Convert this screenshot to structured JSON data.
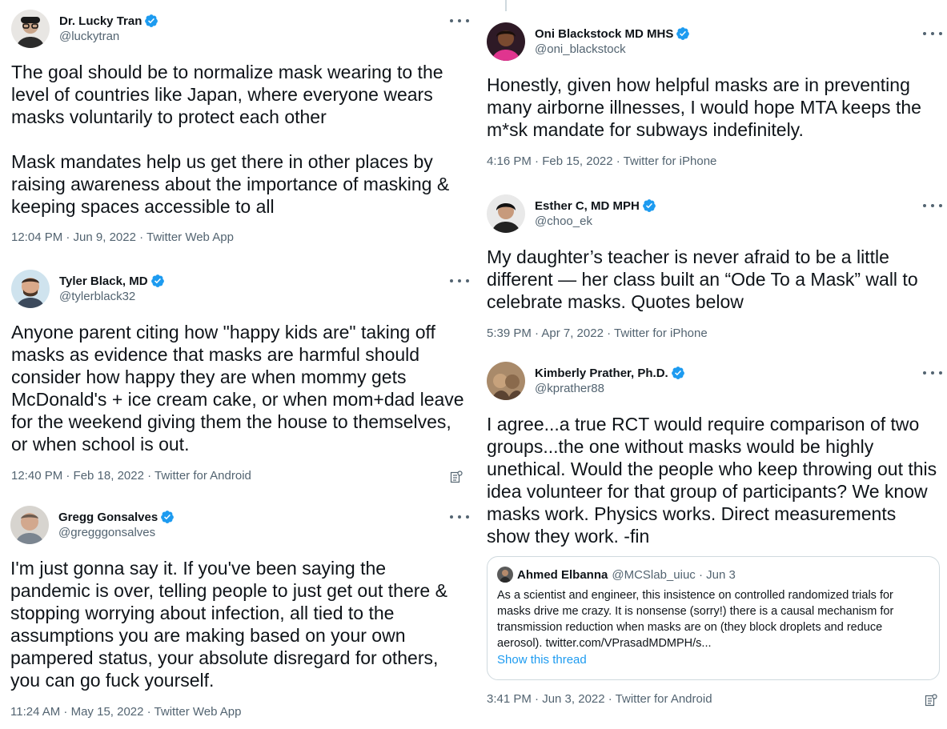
{
  "colors": {
    "verified": "#1d9bf0",
    "secondary_text": "#536471",
    "link": "#1d9bf0",
    "border": "#cfd9de"
  },
  "tweets": [
    {
      "name": "Dr. Lucky Tran",
      "handle": "@luckytran",
      "paragraphs": [
        "The goal should be to normalize mask wearing to the level of countries like Japan, where everyone wears masks voluntarily to protect each other",
        "Mask mandates help us get there in other places by raising awareness about the importance of masking & keeping spaces accessible to all"
      ],
      "meta": "12:04 PM · Jun 9, 2022 · Twitter Web App"
    },
    {
      "name": "Tyler Black, MD",
      "handle": "@tylerblack32",
      "paragraphs": [
        "Anyone parent citing how \"happy kids are\" taking off masks as evidence that masks are harmful should consider how happy they are when mommy gets McDonald's + ice cream cake, or when mom+dad leave for the weekend giving them the house to themselves, or when school is out."
      ],
      "meta": "12:40 PM · Feb 18, 2022 · Twitter for Android"
    },
    {
      "name": "Gregg Gonsalves",
      "handle": "@gregggonsalves",
      "paragraphs": [
        "I'm just gonna say it. If you've been saying the pandemic is over, telling people to just get out there & stopping worrying about infection, all tied to the assumptions you are making based on your own pampered status, your absolute disregard for others, you can go fuck yourself."
      ],
      "meta": "11:24 AM · May 15, 2022 · Twitter Web App"
    },
    {
      "name": "Oni Blackstock MD MHS",
      "handle": "@oni_blackstock",
      "paragraphs": [
        "Honestly, given how helpful masks are in preventing many airborne illnesses, I would hope MTA keeps the m*sk mandate for subways indefinitely."
      ],
      "meta": "4:16 PM · Feb 15, 2022 · Twitter for iPhone"
    },
    {
      "name": "Esther C, MD MPH",
      "handle": "@choo_ek",
      "paragraphs": [
        "My daughter’s teacher is never afraid to be a little different — her class built an “Ode To a Mask” wall to celebrate masks. Quotes below"
      ],
      "meta": "5:39 PM · Apr 7, 2022 · Twitter for iPhone"
    },
    {
      "name": "Kimberly Prather, Ph.D.",
      "handle": "@kprather88",
      "paragraphs": [
        "I agree...a true RCT would require comparison of two groups...the one without masks would be highly unethical. Would the people who keep throwing out this idea volunteer for that group of participants? We know masks work. Physics works. Direct measurements show they work. -fin"
      ],
      "meta": "3:41 PM · Jun 3, 2022 · Twitter for Android",
      "quote": {
        "name": "Ahmed Elbanna",
        "handle_date": "@MCSlab_uiuc · Jun 3",
        "text": "As a scientist and engineer, this insistence on controlled randomized trials for masks drive me crazy. It is nonsense (sorry!) there is a causal mechanism for transmission reduction when masks are on (they block droplets and reduce aerosol). twitter.com/VPrasadMDMPH/s...",
        "link": "Show this thread"
      }
    }
  ]
}
